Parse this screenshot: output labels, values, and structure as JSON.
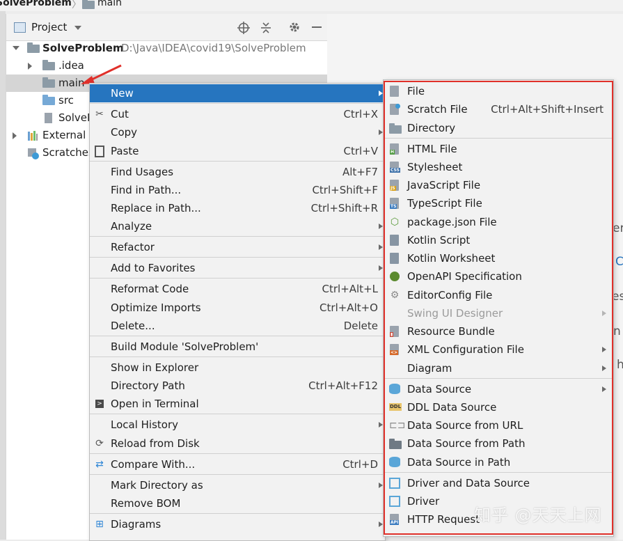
{
  "breadcrumb": {
    "project": "SolveProblem",
    "separator": "〉",
    "folder": "main"
  },
  "project_panel": {
    "title": "Project",
    "tree": [
      {
        "name": "SolveProblem",
        "path": "D:\\Java\\IDEA\\covid19\\SolveProblem"
      },
      {
        "name": ".idea"
      },
      {
        "name": "main"
      },
      {
        "name": "src"
      },
      {
        "name": "SolveP"
      },
      {
        "name": "External L"
      },
      {
        "name": "Scratches"
      }
    ]
  },
  "context_menu": {
    "new": "New",
    "cut": {
      "label": "Cut",
      "shortcut": "Ctrl+X"
    },
    "copy": "Copy",
    "paste": {
      "label": "Paste",
      "shortcut": "Ctrl+V"
    },
    "find_usages": {
      "label": "Find Usages",
      "shortcut": "Alt+F7"
    },
    "find_in_path": {
      "label": "Find in Path...",
      "shortcut": "Ctrl+Shift+F"
    },
    "replace_in_path": {
      "label": "Replace in Path...",
      "shortcut": "Ctrl+Shift+R"
    },
    "analyze": "Analyze",
    "refactor": "Refactor",
    "add_to_favorites": "Add to Favorites",
    "reformat_code": {
      "label": "Reformat Code",
      "shortcut": "Ctrl+Alt+L"
    },
    "optimize_imports": {
      "label": "Optimize Imports",
      "shortcut": "Ctrl+Alt+O"
    },
    "delete": {
      "label": "Delete...",
      "shortcut": "Delete"
    },
    "build_module": "Build Module 'SolveProblem'",
    "show_in_explorer": "Show in Explorer",
    "directory_path": {
      "label": "Directory Path",
      "shortcut": "Ctrl+Alt+F12"
    },
    "open_in_terminal": "Open in Terminal",
    "local_history": "Local History",
    "reload_from_disk": "Reload from Disk",
    "compare_with": {
      "label": "Compare With...",
      "shortcut": "Ctrl+D"
    },
    "mark_directory_as": "Mark Directory as",
    "remove_bom": "Remove BOM",
    "diagrams": "Diagrams"
  },
  "new_submenu": {
    "file": "File",
    "scratch_file": {
      "label": "Scratch File",
      "shortcut": "Ctrl+Alt+Shift+Insert"
    },
    "directory": "Directory",
    "html_file": "HTML File",
    "stylesheet": "Stylesheet",
    "javascript_file": "JavaScript File",
    "typescript_file": "TypeScript File",
    "package_json": "package.json File",
    "kotlin_script": "Kotlin Script",
    "kotlin_worksheet": "Kotlin Worksheet",
    "openapi": "OpenAPI Specification",
    "editorconfig": "EditorConfig File",
    "swing_ui": "Swing UI Designer",
    "resource_bundle": "Resource Bundle",
    "xml_config": "XML Configuration File",
    "diagram": "Diagram",
    "data_source": "Data Source",
    "ddl_data_source": "DDL Data Source",
    "data_source_url": "Data Source from URL",
    "data_source_path": "Data Source from Path",
    "data_source_in_path": "Data Source in Path",
    "driver_and_data_source": "Driver and Data Source",
    "driver": "Driver",
    "http_request": "HTTP Request"
  },
  "icon_badges": {
    "html": "H",
    "css": "CSS",
    "js": "JS",
    "ts": "TS",
    "ddl": "DDL",
    "api": "API"
  },
  "right_fragments": [
    "er",
    "C",
    "es",
    "n",
    "h"
  ],
  "watermark": "知乎 @天天上网"
}
